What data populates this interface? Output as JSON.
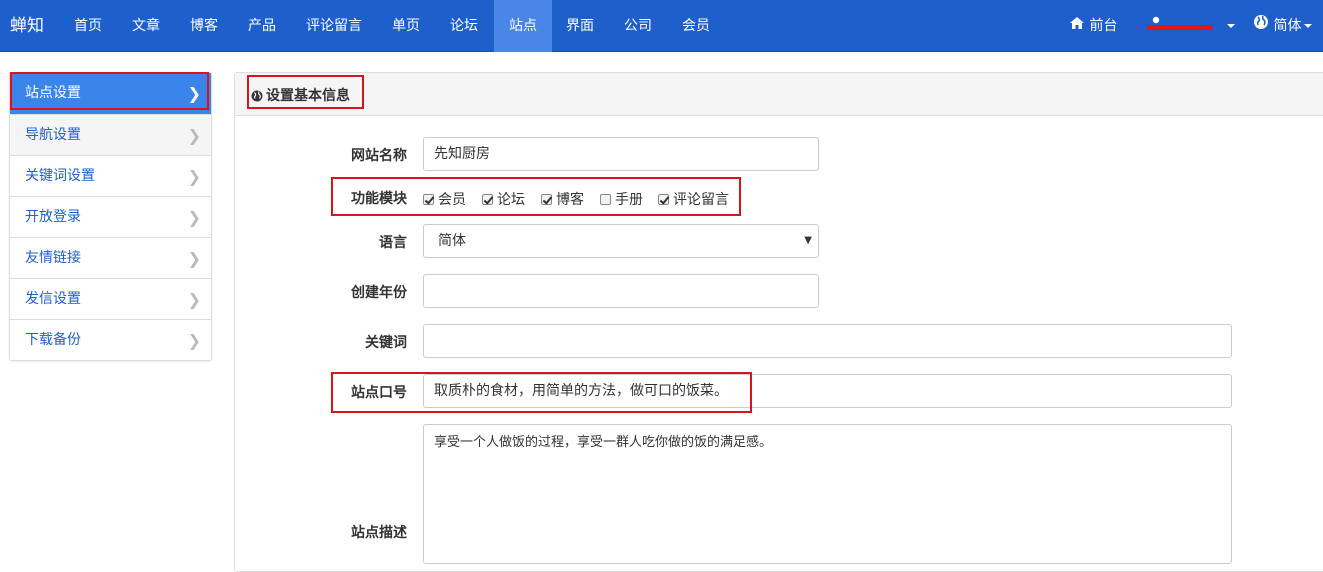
{
  "navbar": {
    "brand": "蝉知",
    "items": [
      "首页",
      "文章",
      "博客",
      "产品",
      "评论留言",
      "单页",
      "论坛",
      "站点",
      "界面",
      "公司",
      "会员"
    ],
    "active_index": 7,
    "frontend_label": "前台",
    "language_label": "简体",
    "user_icon": "user-icon",
    "home_icon": "home-icon",
    "globe_icon": "globe-icon"
  },
  "sidebar": {
    "items": [
      {
        "label": "站点设置",
        "state": "active"
      },
      {
        "label": "导航设置",
        "state": "hover"
      },
      {
        "label": "关键词设置",
        "state": "normal"
      },
      {
        "label": "开放登录",
        "state": "normal"
      },
      {
        "label": "友情链接",
        "state": "normal"
      },
      {
        "label": "发信设置",
        "state": "normal"
      },
      {
        "label": "下载备份",
        "state": "normal"
      }
    ]
  },
  "panel": {
    "title": "设置基本信息"
  },
  "form": {
    "site_name": {
      "label": "网站名称",
      "value": "先知厨房"
    },
    "modules": {
      "label": "功能模块",
      "options": [
        {
          "label": "会员",
          "checked": true
        },
        {
          "label": "论坛",
          "checked": true
        },
        {
          "label": "博客",
          "checked": true
        },
        {
          "label": "手册",
          "checked": false
        },
        {
          "label": "评论留言",
          "checked": true
        }
      ]
    },
    "language": {
      "label": "语言",
      "value": "简体"
    },
    "year": {
      "label": "创建年份",
      "value": ""
    },
    "keywords": {
      "label": "关键词",
      "value": ""
    },
    "slogan": {
      "label": "站点口号",
      "value": "取质朴的食材，用简单的方法，做可口的饭菜。"
    },
    "description": {
      "label": "站点描述",
      "value": "享受一个人做饭的过程，享受一群人吃你做的饭的满足感。"
    }
  },
  "colors": {
    "navbar": "#1e5fcc",
    "nav_active": "#4a86e8",
    "sidebar_active": "#3a85e9",
    "highlight": "#d9141c"
  }
}
